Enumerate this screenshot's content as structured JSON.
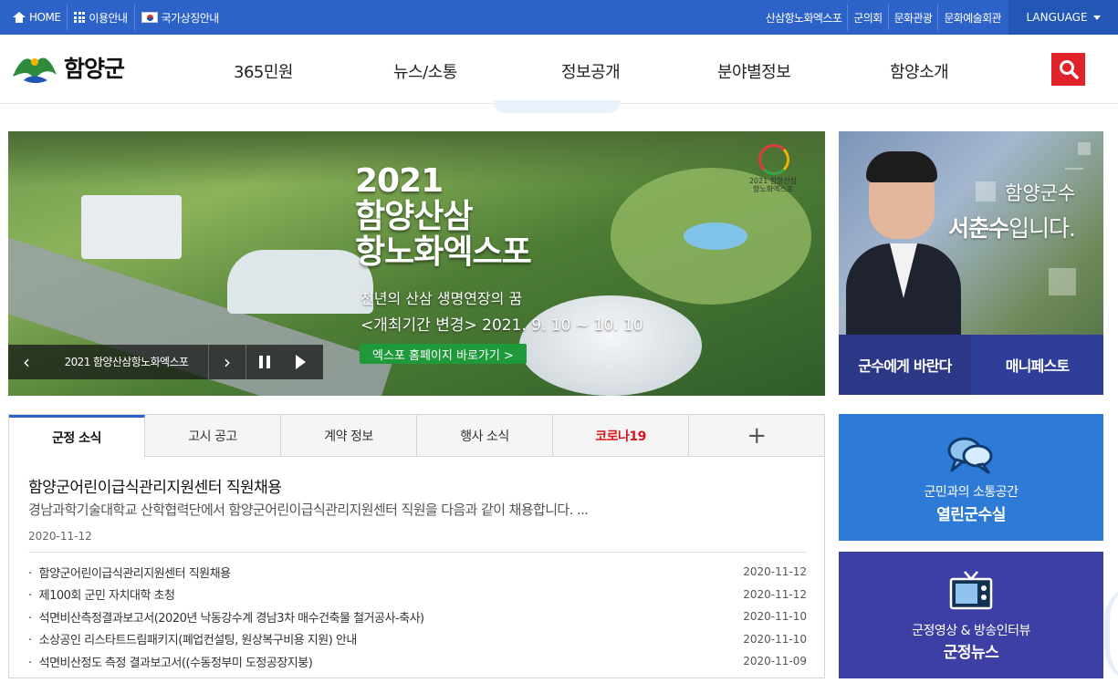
{
  "topbar": {
    "left": [
      {
        "label": "HOME",
        "icon": "home-icon"
      },
      {
        "label": "이용안내",
        "icon": "grid-icon"
      },
      {
        "label": "국가상징안내",
        "icon": "flag-icon"
      }
    ],
    "right": [
      "산삼항노화엑스포",
      "군의회",
      "문화관광",
      "문화예술회관"
    ],
    "language": "LANGUAGE",
    "colors": {
      "bar": "#2d63c8",
      "language_bg": "#2257b5"
    }
  },
  "header": {
    "logo_text": "함양군",
    "nav": [
      "365민원",
      "뉴스/소통",
      "정보공개",
      "분야별정보",
      "함양소개"
    ],
    "search_icon": "search-icon",
    "search_color": "#e0222b"
  },
  "banner": {
    "title": "2021\n함양산삼\n항노화엑스포",
    "subtitle": "천년의 산삼 생명연장의 꿈",
    "date": "<개최기간 변경> 2021. 9. 10 ~ 10. 10",
    "button": "엑스포 홈페이지 바로가기  >",
    "logo_text": "2021 함양산삼 항노화엑스포",
    "control_label": "2021 함양산삼항노화엑스포",
    "prev_icon": "chevron-left-icon",
    "next_icon": "chevron-right-icon",
    "pause_icon": "pause-icon",
    "play_icon": "play-icon"
  },
  "mayor": {
    "line1": "함양군수",
    "name": "서춘수",
    "suffix": "입니다.",
    "buttons": [
      "군수에게 바란다",
      "매니페스토"
    ],
    "button_colors": [
      "#2c3787",
      "#2f3f99"
    ]
  },
  "news": {
    "tabs": [
      "군정 소식",
      "고시 공고",
      "계약 정보",
      "행사 소식",
      "코로나19",
      "+"
    ],
    "featured": {
      "title": "함양군어린이급식관리지원센터 직원채용",
      "desc": "경남과학기술대학교 산학협력단에서 함양군어린이급식관리지원센터 직원을 다음과 같이 채용합니다. ...",
      "date": "2020-11-12"
    },
    "items": [
      {
        "title": "함양군어린이급식관리지원센터 직원채용",
        "date": "2020-11-12"
      },
      {
        "title": "제100회 군민 자치대학 초청",
        "date": "2020-11-12"
      },
      {
        "title": "석면비산측정결과보고서(2020년 낙동강수계 경남3차 매수건축물 철거공사-축사)",
        "date": "2020-11-10"
      },
      {
        "title": "소상공인 리스타트드림패키지(폐업컨설팅, 원상복구비용 지원) 안내",
        "date": "2020-11-10"
      },
      {
        "title": "석면비산정도 측정 결과보고서((수동정부미 도정공장지붕)",
        "date": "2020-11-09"
      }
    ]
  },
  "blocks": [
    {
      "small": "군민과의 소통공간",
      "big": "열린군수실",
      "icon": "speech-bubbles-icon",
      "color": "#2d7bd6"
    },
    {
      "small": "군정영상 & 방송인터뷰",
      "big": "군정뉴스",
      "icon": "tv-icon",
      "color": "#3d3fa5"
    }
  ]
}
